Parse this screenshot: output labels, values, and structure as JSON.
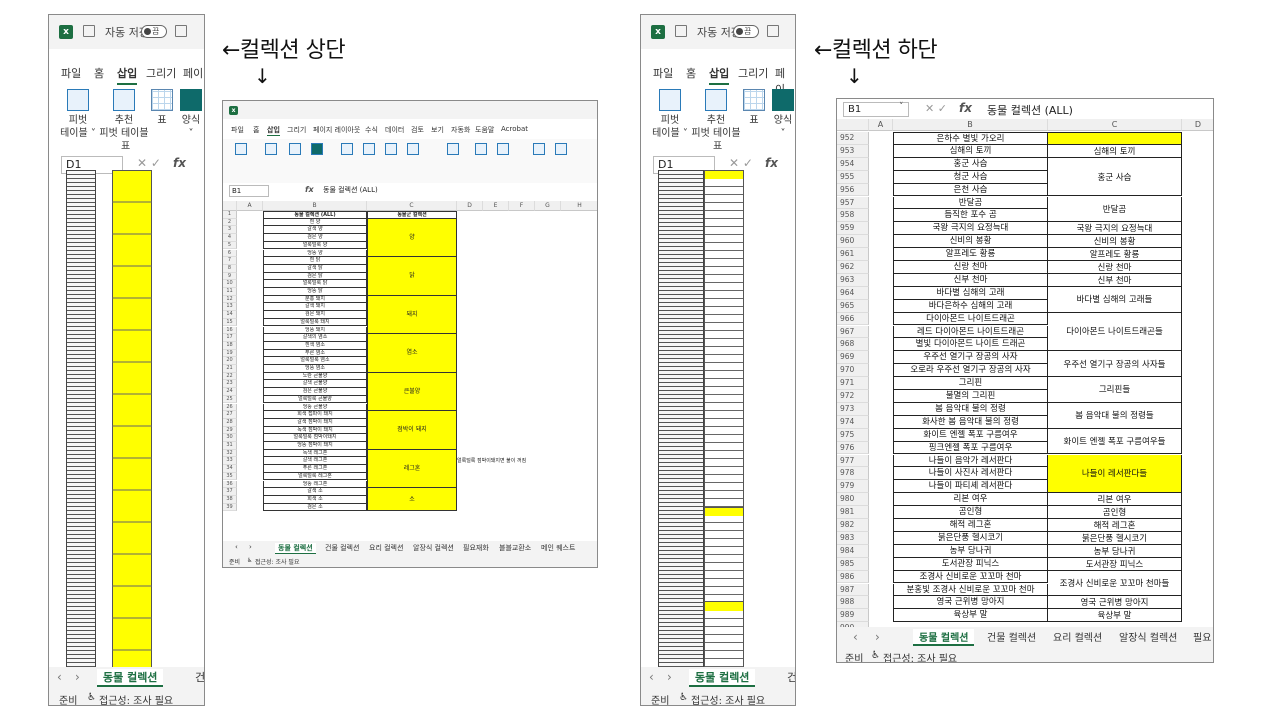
{
  "captions": {
    "top": "←컬렉션 상단",
    "bottom": "←컬렉션 하단",
    "down_arrow": "↓"
  },
  "excel": {
    "autosave_label": "자동 저장",
    "toggle_state": "끔",
    "menu": [
      "파일",
      "홈",
      "삽입",
      "그리기",
      "페이"
    ],
    "active_menu": "삽입",
    "ribbon": {
      "pivot": "피벗\n테이블 ˅",
      "recommended_pivot": "추천\n피벗 테이블",
      "table": "표",
      "forms": "양식\n˅",
      "group_label": "표"
    },
    "namebox_left": "D1",
    "sheet_tab_active": "동물 컬렉션",
    "sheet_tab_next": "건",
    "status_ready": "준비",
    "status_accessibility": "접근성: 조사 필요"
  },
  "top_window": {
    "menu": [
      "파일",
      "홈",
      "삽입",
      "그리기",
      "페이지 레이아웃",
      "수식",
      "데이터",
      "검토",
      "보기",
      "자동화",
      "도움말",
      "Acrobat"
    ],
    "active_menu": "삽입",
    "namebox": "B1",
    "formula": "동물 컬렉션 (ALL)",
    "col_headers": [
      "A",
      "B",
      "C",
      "D",
      "E",
      "F",
      "G",
      "H"
    ],
    "header_b": "동물 컬렉션 (ALL)",
    "header_c": "동물군 컬렉션",
    "rows_b": [
      "흰 양",
      "갈색 양",
      "검은 양",
      "얼룩덜룩 양",
      "엉뚱 양",
      "흰 닭",
      "갈색 닭",
      "검은 닭",
      "얼룩덜룩 닭",
      "엉뚱 닭",
      "분홍 돼지",
      "갈색 돼지",
      "검은 돼지",
      "얼룩덜룩 돼지",
      "엉뚱 돼지",
      "갈색의 염소",
      "흰색 염소",
      "푸른 염소",
      "얼룩덜룩 염소",
      "엉뚱 염소",
      "노란 큰불양",
      "갈색 큰불양",
      "검은 큰불양",
      "얼룩덜룩 큰불양",
      "엉뚱 큰불양",
      "회색 접파이 돼지",
      "갈색 점박이 돼지",
      "녹색 점박이 돼지",
      "얼룩덜룩 점박이돼지",
      "엉뚱 점박이 돼지",
      "녹색 레그혼",
      "갈색 레그혼",
      "푸른 레그혼",
      "얼룩덜룩 레그혼",
      "엉뚱 레그혼",
      "갈색 소",
      "회색 소",
      "검은 소"
    ],
    "groups_c": [
      {
        "label": "양",
        "rows": 5
      },
      {
        "label": "닭",
        "rows": 5
      },
      {
        "label": "돼지",
        "rows": 5
      },
      {
        "label": "염소",
        "rows": 5
      },
      {
        "label": "큰불양",
        "rows": 5
      },
      {
        "label": "점박이 돼지",
        "rows": 5
      },
      {
        "label": "레그혼",
        "rows": 5
      },
      {
        "label": "소",
        "rows": 3
      }
    ],
    "note": "얼룩덜룩 점박이돼지면 불이 꺼짐",
    "tabs": [
      "동물 컬렉션",
      "건물 컬렉션",
      "요리 컬렉션",
      "알장식 컬렉션",
      "필요재화",
      "블블교환소",
      "메인 퀘스트"
    ],
    "status_ready": "준비",
    "status_accessibility": "접근성: 조사 필요"
  },
  "bottom_window": {
    "namebox": "B1",
    "formula": "동물 컬렉션 (ALL)",
    "col_headers": [
      "A",
      "B",
      "C",
      "D"
    ],
    "rows": [
      {
        "n": "952",
        "b": "은하수 별빛 가오리"
      },
      {
        "n": "953",
        "b": "심해의 토끼"
      },
      {
        "n": "954",
        "b": "홍군 사슴"
      },
      {
        "n": "955",
        "b": "청군 사슴"
      },
      {
        "n": "956",
        "b": "은천 사슴"
      },
      {
        "n": "957",
        "b": "반달곰"
      },
      {
        "n": "958",
        "b": "듬직한 포수 곰"
      },
      {
        "n": "959",
        "b": "국왕 극지의 요정늑대"
      },
      {
        "n": "960",
        "b": "신비의 봉황"
      },
      {
        "n": "961",
        "b": "알프레도 황룡"
      },
      {
        "n": "962",
        "b": "신랑 천마"
      },
      {
        "n": "963",
        "b": "신부 천마"
      },
      {
        "n": "964",
        "b": "바다별 심해의 고래"
      },
      {
        "n": "965",
        "b": "바다은하수 심해의 고래"
      },
      {
        "n": "966",
        "b": "다이아몬드 나이트드래곤"
      },
      {
        "n": "967",
        "b": "레드 다이아몬드 나이트드래곤"
      },
      {
        "n": "968",
        "b": "별빛 다이아몬드 나이트 드래곤"
      },
      {
        "n": "969",
        "b": "우주선 열기구 장공의 사자"
      },
      {
        "n": "970",
        "b": "오로라 우주선 열기구 장공의 사자"
      },
      {
        "n": "971",
        "b": "그리핀"
      },
      {
        "n": "972",
        "b": "불멸의 그리핀"
      },
      {
        "n": "973",
        "b": "봄 음악대 불의 정령"
      },
      {
        "n": "974",
        "b": "화사한 봄 음악대 불의 정령"
      },
      {
        "n": "975",
        "b": "화이트 엔젤 폭포 구름여우"
      },
      {
        "n": "976",
        "b": "핑크엔젤 폭포 구름여우"
      },
      {
        "n": "977",
        "b": "나들이 음악가 레서판다"
      },
      {
        "n": "978",
        "b": "나들이 사진사 레서판다"
      },
      {
        "n": "979",
        "b": "나들이 파티셰 레서판다"
      },
      {
        "n": "980",
        "b": "리본 여우"
      },
      {
        "n": "981",
        "b": "곰인형"
      },
      {
        "n": "982",
        "b": "해적 레그혼"
      },
      {
        "n": "983",
        "b": "붉은단풍 헬시코기"
      },
      {
        "n": "984",
        "b": "농부 당나귀"
      },
      {
        "n": "985",
        "b": "도서관장 피닉스"
      },
      {
        "n": "986",
        "b": "조경사 신비로운 꼬꼬마 천마"
      },
      {
        "n": "987",
        "b": "분홍빛 조경사 신비로운 꼬꼬마 천마"
      },
      {
        "n": "988",
        "b": "영국 근위병 망아지"
      },
      {
        "n": "989",
        "b": "육상부 말"
      },
      {
        "n": "990",
        "b": ""
      }
    ],
    "c_groups": [
      {
        "start": 0,
        "span": 1,
        "label": "",
        "yellow": true
      },
      {
        "start": 1,
        "span": 1,
        "label": "심해의 토끼",
        "yellow": false
      },
      {
        "start": 2,
        "span": 3,
        "label": "홍군 사슴",
        "yellow": false
      },
      {
        "start": 5,
        "span": 2,
        "label": "반달곰",
        "yellow": false
      },
      {
        "start": 7,
        "span": 1,
        "label": "국왕 극지의 요정늑대",
        "yellow": false
      },
      {
        "start": 8,
        "span": 1,
        "label": "신비의 봉황",
        "yellow": false
      },
      {
        "start": 9,
        "span": 1,
        "label": "알프레도 황룡",
        "yellow": false
      },
      {
        "start": 10,
        "span": 1,
        "label": "신랑 천마",
        "yellow": false
      },
      {
        "start": 11,
        "span": 1,
        "label": "신부 천마",
        "yellow": false
      },
      {
        "start": 12,
        "span": 2,
        "label": "바다별 심해의 고래들",
        "yellow": false
      },
      {
        "start": 14,
        "span": 3,
        "label": "다이아몬드 나이트드래곤들",
        "yellow": false
      },
      {
        "start": 17,
        "span": 2,
        "label": "우주선 열기구 장공의 사자들",
        "yellow": false
      },
      {
        "start": 19,
        "span": 2,
        "label": "그리핀들",
        "yellow": false
      },
      {
        "start": 21,
        "span": 2,
        "label": "봄 음악대 불의 정령들",
        "yellow": false
      },
      {
        "start": 23,
        "span": 2,
        "label": "화이트 엔젤 폭포 구름여우들",
        "yellow": false
      },
      {
        "start": 25,
        "span": 3,
        "label": "나들이 레서판다들",
        "yellow": true
      },
      {
        "start": 28,
        "span": 1,
        "label": "리본 여우",
        "yellow": false
      },
      {
        "start": 29,
        "span": 1,
        "label": "곰인형",
        "yellow": false
      },
      {
        "start": 30,
        "span": 1,
        "label": "해적 레그혼",
        "yellow": false
      },
      {
        "start": 31,
        "span": 1,
        "label": "붉은단풍 헬시코기",
        "yellow": false
      },
      {
        "start": 32,
        "span": 1,
        "label": "농부 당나귀",
        "yellow": false
      },
      {
        "start": 33,
        "span": 1,
        "label": "도서관장 피닉스",
        "yellow": false
      },
      {
        "start": 34,
        "span": 2,
        "label": "조경사 신비로운 꼬꼬마 천마들",
        "yellow": false
      },
      {
        "start": 36,
        "span": 1,
        "label": "영국 근위병 망아지",
        "yellow": false
      },
      {
        "start": 37,
        "span": 1,
        "label": "육상부 말",
        "yellow": false
      }
    ],
    "tabs": [
      "동물 컬렉션",
      "건물 컬렉션",
      "요리 컬렉션",
      "알장식 컬렉션",
      "필요"
    ],
    "status_ready": "준비",
    "status_accessibility": "접근성: 조사 필요"
  }
}
